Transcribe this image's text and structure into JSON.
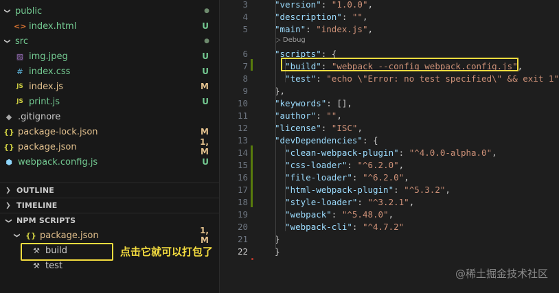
{
  "explorer": {
    "items": [
      {
        "name": "public",
        "icon": "folder-chevron",
        "status": "dot",
        "status_color": "#6d8a6d"
      },
      {
        "name": "index.html",
        "icon": "html-icon",
        "status": "U"
      },
      {
        "name": "src",
        "icon": "folder-chevron",
        "status": "dot"
      },
      {
        "name": "img.jpeg",
        "icon": "image-icon",
        "status": "U"
      },
      {
        "name": "index.css",
        "icon": "css-icon",
        "status": "U"
      },
      {
        "name": "index.js",
        "icon": "js-icon",
        "status": "M"
      },
      {
        "name": "print.js",
        "icon": "js-icon",
        "status": "U"
      },
      {
        "name": ".gitignore",
        "icon": "git-icon",
        "status": ""
      },
      {
        "name": "package-lock.json",
        "icon": "json-icon",
        "status": "M"
      },
      {
        "name": "package.json",
        "icon": "json-icon",
        "status": "1, M"
      },
      {
        "name": "webpack.config.js",
        "icon": "webpack-icon",
        "status": "U"
      }
    ],
    "icon_glyphs": {
      "html": "<>",
      "css": "#",
      "js": "JS",
      "json": "{}",
      "git": "◆",
      "webpack": "⬢",
      "image": "▨"
    }
  },
  "sections": {
    "outline": "OUTLINE",
    "timeline": "TIMELINE",
    "npm_scripts": "NPM SCRIPTS"
  },
  "npm": {
    "package": "package.json",
    "package_status": "1, M",
    "scripts": [
      "build",
      "test"
    ]
  },
  "annotation": "点击它就可以打包了",
  "editor": {
    "codelens": "▷ Debug",
    "lines": [
      {
        "n": "3",
        "code": [
          [
            "k",
            "\"version\""
          ],
          [
            "p",
            ": "
          ],
          [
            "s",
            "\"1.0.0\""
          ],
          [
            "p",
            ","
          ]
        ]
      },
      {
        "n": "4",
        "code": [
          [
            "k",
            "\"description\""
          ],
          [
            "p",
            ": "
          ],
          [
            "s",
            "\"\""
          ],
          [
            "p",
            ","
          ]
        ]
      },
      {
        "n": "5",
        "code": [
          [
            "k",
            "\"main\""
          ],
          [
            "p",
            ": "
          ],
          [
            "s",
            "\"index.js\""
          ],
          [
            "p",
            ","
          ]
        ]
      },
      {
        "n": "6",
        "code": [
          [
            "k",
            "\"scripts\""
          ],
          [
            "p",
            ": {"
          ]
        ]
      },
      {
        "n": "7",
        "code": [
          [
            "p",
            "  "
          ],
          [
            "k",
            "\"build\""
          ],
          [
            "p",
            ": "
          ],
          [
            "s",
            "\"webpack --config webpack.config.js\""
          ],
          [
            "p",
            ","
          ]
        ]
      },
      {
        "n": "8",
        "code": [
          [
            "p",
            "  "
          ],
          [
            "k",
            "\"test\""
          ],
          [
            "p",
            ": "
          ],
          [
            "s",
            "\"echo \\\"Error: no test specified\\\" && exit 1\""
          ]
        ]
      },
      {
        "n": "9",
        "code": [
          [
            "p",
            "},"
          ]
        ]
      },
      {
        "n": "10",
        "code": [
          [
            "k",
            "\"keywords\""
          ],
          [
            "p",
            ": [],"
          ]
        ]
      },
      {
        "n": "11",
        "code": [
          [
            "k",
            "\"author\""
          ],
          [
            "p",
            ": "
          ],
          [
            "s",
            "\"\""
          ],
          [
            "p",
            ","
          ]
        ]
      },
      {
        "n": "12",
        "code": [
          [
            "k",
            "\"license\""
          ],
          [
            "p",
            ": "
          ],
          [
            "s",
            "\"ISC\""
          ],
          [
            "p",
            ","
          ]
        ]
      },
      {
        "n": "13",
        "code": [
          [
            "k",
            "\"devDependencies\""
          ],
          [
            "p",
            ": {"
          ]
        ]
      },
      {
        "n": "14",
        "code": [
          [
            "p",
            "  "
          ],
          [
            "k",
            "\"clean-webpack-plugin\""
          ],
          [
            "p",
            ": "
          ],
          [
            "s",
            "\"^4.0.0-alpha.0\""
          ],
          [
            "p",
            ","
          ]
        ]
      },
      {
        "n": "15",
        "code": [
          [
            "p",
            "  "
          ],
          [
            "k",
            "\"css-loader\""
          ],
          [
            "p",
            ": "
          ],
          [
            "s",
            "\"^6.2.0\""
          ],
          [
            "p",
            ","
          ]
        ]
      },
      {
        "n": "16",
        "code": [
          [
            "p",
            "  "
          ],
          [
            "k",
            "\"file-loader\""
          ],
          [
            "p",
            ": "
          ],
          [
            "s",
            "\"^6.2.0\""
          ],
          [
            "p",
            ","
          ]
        ]
      },
      {
        "n": "17",
        "code": [
          [
            "p",
            "  "
          ],
          [
            "k",
            "\"html-webpack-plugin\""
          ],
          [
            "p",
            ": "
          ],
          [
            "s",
            "\"^5.3.2\""
          ],
          [
            "p",
            ","
          ]
        ]
      },
      {
        "n": "18",
        "code": [
          [
            "p",
            "  "
          ],
          [
            "k",
            "\"style-loader\""
          ],
          [
            "p",
            ": "
          ],
          [
            "s",
            "\"^3.2.1\""
          ],
          [
            "p",
            ","
          ]
        ]
      },
      {
        "n": "19",
        "code": [
          [
            "p",
            "  "
          ],
          [
            "k",
            "\"webpack\""
          ],
          [
            "p",
            ": "
          ],
          [
            "s",
            "\"^5.48.0\""
          ],
          [
            "p",
            ","
          ]
        ]
      },
      {
        "n": "20",
        "code": [
          [
            "p",
            "  "
          ],
          [
            "k",
            "\"webpack-cli\""
          ],
          [
            "p",
            ": "
          ],
          [
            "s",
            "\"^4.7.2\""
          ]
        ]
      },
      {
        "n": "21",
        "code": [
          [
            "p",
            "}"
          ]
        ]
      },
      {
        "n": "22",
        "code": [
          [
            "p",
            "}"
          ]
        ]
      }
    ]
  },
  "watermark": "@稀土掘金技术社区",
  "colors": {
    "highlight": "#f5dd3f",
    "untracked": "#73c991",
    "modified": "#e2c08d"
  }
}
